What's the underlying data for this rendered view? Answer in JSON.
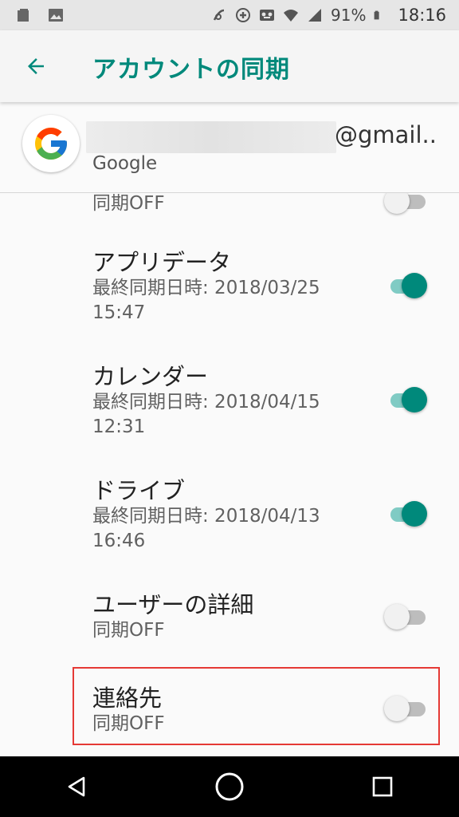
{
  "status_bar": {
    "battery": "91%",
    "time": "18:16"
  },
  "app_bar": {
    "title": "アカウントの同期",
    "back_icon": "arrow-back-icon"
  },
  "account": {
    "email_suffix": "@gmail..",
    "type": "Google",
    "avatar_icon": "google-g-icon"
  },
  "sync_items": [
    {
      "title": "",
      "subtitle": "同期OFF",
      "enabled": false
    },
    {
      "title": "アプリデータ",
      "subtitle": "最終同期日時: 2018/03/25 15:47",
      "enabled": true
    },
    {
      "title": "カレンダー",
      "subtitle": "最終同期日時: 2018/04/15 12:31",
      "enabled": true
    },
    {
      "title": "ドライブ",
      "subtitle": "最終同期日時: 2018/04/13 16:46",
      "enabled": true
    },
    {
      "title": "ユーザーの詳細",
      "subtitle": "同期OFF",
      "enabled": false
    },
    {
      "title": "連絡先",
      "subtitle": "同期OFF",
      "enabled": false
    }
  ],
  "colors": {
    "accent": "#00897b",
    "accent_track": "#80cbc4",
    "highlight": "#e53935"
  },
  "nav_bar": {
    "back_icon": "nav-back-icon",
    "home_icon": "nav-home-icon",
    "recents_icon": "nav-recents-icon"
  }
}
